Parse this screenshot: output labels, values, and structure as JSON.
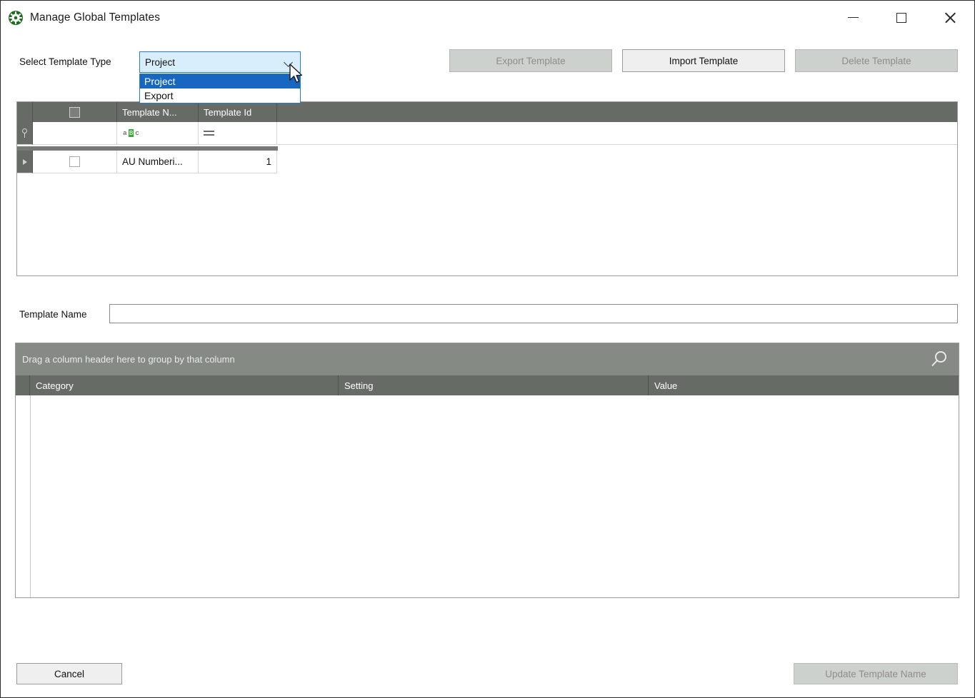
{
  "window": {
    "title": "Manage Global Templates",
    "icon": "gear-icon",
    "controls": {
      "minimize": "minimize-icon",
      "maximize": "maximize-icon",
      "close": "close-icon"
    }
  },
  "form": {
    "template_type_label": "Select Template Type",
    "template_type_value": "Project",
    "template_type_options": [
      "Project",
      "Export"
    ],
    "template_type_selected_index": 0,
    "template_type_expanded": true,
    "template_name_label": "Template Name",
    "template_name_value": "",
    "template_name_placeholder": ""
  },
  "toolbar": {
    "export_label": "Export Template",
    "export_enabled": false,
    "import_label": "Import Template",
    "import_enabled": true,
    "delete_label": "Delete Template",
    "delete_enabled": false
  },
  "templates_grid": {
    "columns": [
      "",
      "",
      "Template N...",
      "Template Id",
      ""
    ],
    "filter_row": {
      "indicator_icon": "key-icon",
      "select_filter": "",
      "name_filter_icon": "abc-filter-icon",
      "name_filter_letters": [
        "a",
        "B",
        "c"
      ],
      "id_filter_icon": "equals-filter-icon"
    },
    "rows": [
      {
        "indicator": "row-arrow-icon",
        "selected": false,
        "template_name": "AU Numberi...",
        "template_id": "1"
      }
    ]
  },
  "settings_grid": {
    "group_panel_text": "Drag a column header here to group by that column",
    "search_icon": "search-icon",
    "columns": [
      "Category",
      "Setting",
      "Value"
    ],
    "rows": []
  },
  "footer": {
    "cancel_label": "Cancel",
    "cancel_enabled": true,
    "update_label": "Update Template Name",
    "update_enabled": false
  },
  "colors": {
    "header_gray": "#666b66",
    "group_panel_gray": "#858a85",
    "combo_highlight": "#1766c0",
    "combo_fill": "#d9eefc",
    "combo_border": "#2c7bbd",
    "disabled_btn": "#cdd1cd",
    "enabled_btn": "#efefef",
    "gear_green": "#1f6b1f"
  }
}
